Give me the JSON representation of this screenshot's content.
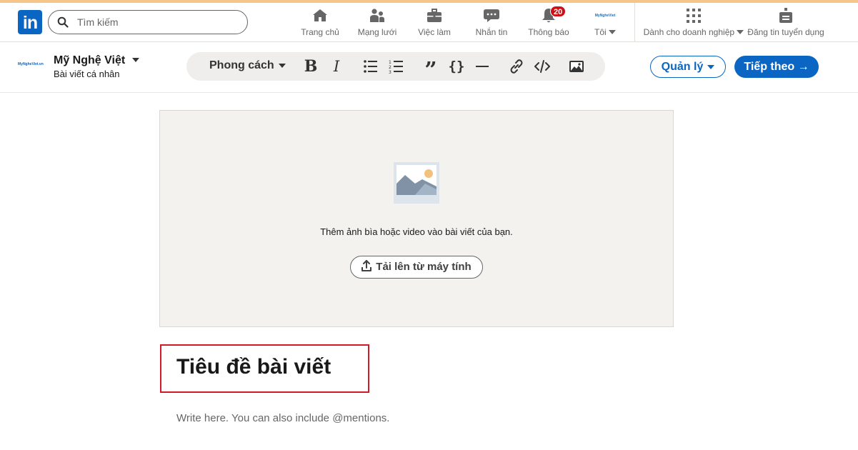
{
  "search": {
    "placeholder": "Tìm kiếm"
  },
  "nav": {
    "items": [
      {
        "label": "Trang chủ",
        "icon": "home-icon"
      },
      {
        "label": "Mạng lưới",
        "icon": "network-icon"
      },
      {
        "label": "Việc làm",
        "icon": "briefcase-icon"
      },
      {
        "label": "Nhắn tin",
        "icon": "messaging-icon"
      },
      {
        "label": "Thông báo",
        "icon": "bell-icon",
        "badge": "20"
      },
      {
        "label": "Tôi",
        "icon": "avatar"
      }
    ],
    "business_label": "Dành cho doanh nghiệp",
    "post_job_label": "Đăng tin tuyển dụng",
    "avatar_text": "MyNgheViet"
  },
  "author": {
    "logo_text": "MyNgheViet.vn",
    "name": "Mỹ Nghệ Việt",
    "subtitle": "Bài viết cá nhân"
  },
  "toolbar": {
    "style_label": "Phong cách",
    "tools": [
      "bold-icon",
      "italic-icon",
      "bulleted-list-icon",
      "numbered-list-icon",
      "quote-icon",
      "code-block-icon",
      "divider-icon",
      "link-icon",
      "embed-icon",
      "image-icon"
    ]
  },
  "actions": {
    "manage_label": "Quản lý",
    "next_label": "Tiếp theo →"
  },
  "cover": {
    "prompt": "Thêm ảnh bìa hoặc video vào bài viết của bạn.",
    "upload_label": "Tải lên từ máy tính"
  },
  "article": {
    "title_placeholder": "Tiêu đề bài viết",
    "body_placeholder": "Write here. You can also include @mentions."
  },
  "colors": {
    "brand": "#0a66c2",
    "badge": "#cc1016",
    "highlight_border": "#d11a2a"
  }
}
